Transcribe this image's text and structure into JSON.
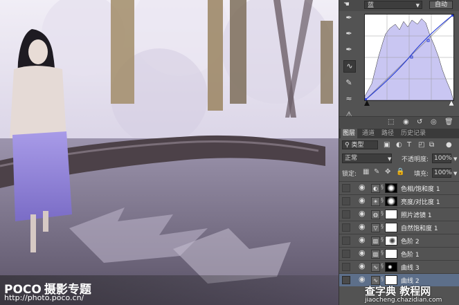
{
  "watermark": {
    "brand": "POCO",
    "brand_sub": "摄影专题",
    "url": "http://photo.poco.cn/",
    "site_main": "查字典 教程网",
    "site_url": "jiaocheng.chazidian.com"
  },
  "curves_panel": {
    "channel": "蓝",
    "auto_label": "自动",
    "tools": [
      "hand-icon",
      "eyedropper-black-icon",
      "eyedropper-gray-icon",
      "eyedropper-white-icon",
      "curve-point-icon",
      "pencil-icon",
      "smooth-icon",
      "histogram-warning-icon"
    ]
  },
  "tabs": [
    "图层",
    "通道",
    "路径",
    "历史记录"
  ],
  "layer_controls": {
    "kind_label": "类型",
    "blend_mode": "正常",
    "opacity_label": "不透明度:",
    "opacity_value": "100%",
    "lock_label": "锁定:",
    "fill_label": "填充:",
    "fill_value": "100%"
  },
  "layers": [
    {
      "name": "色相/饱和度 1",
      "mask": "dark"
    },
    {
      "name": "亮度/对比度 1",
      "mask": "dark"
    },
    {
      "name": "照片滤镜 1",
      "mask": "white"
    },
    {
      "name": "自然饱和度 1",
      "mask": "white"
    },
    {
      "name": "色阶 2",
      "mask": "white"
    },
    {
      "name": "色阶 1",
      "mask": "white"
    },
    {
      "name": "曲线 3",
      "mask": "dark"
    },
    {
      "name": "曲线 2",
      "mask": "white"
    }
  ],
  "colors": {
    "panel_bg": "#535353",
    "selected_layer": "#5d6f8a",
    "histogram_fill": "#c9c6f2",
    "curve_line": "#2a3fd6"
  }
}
